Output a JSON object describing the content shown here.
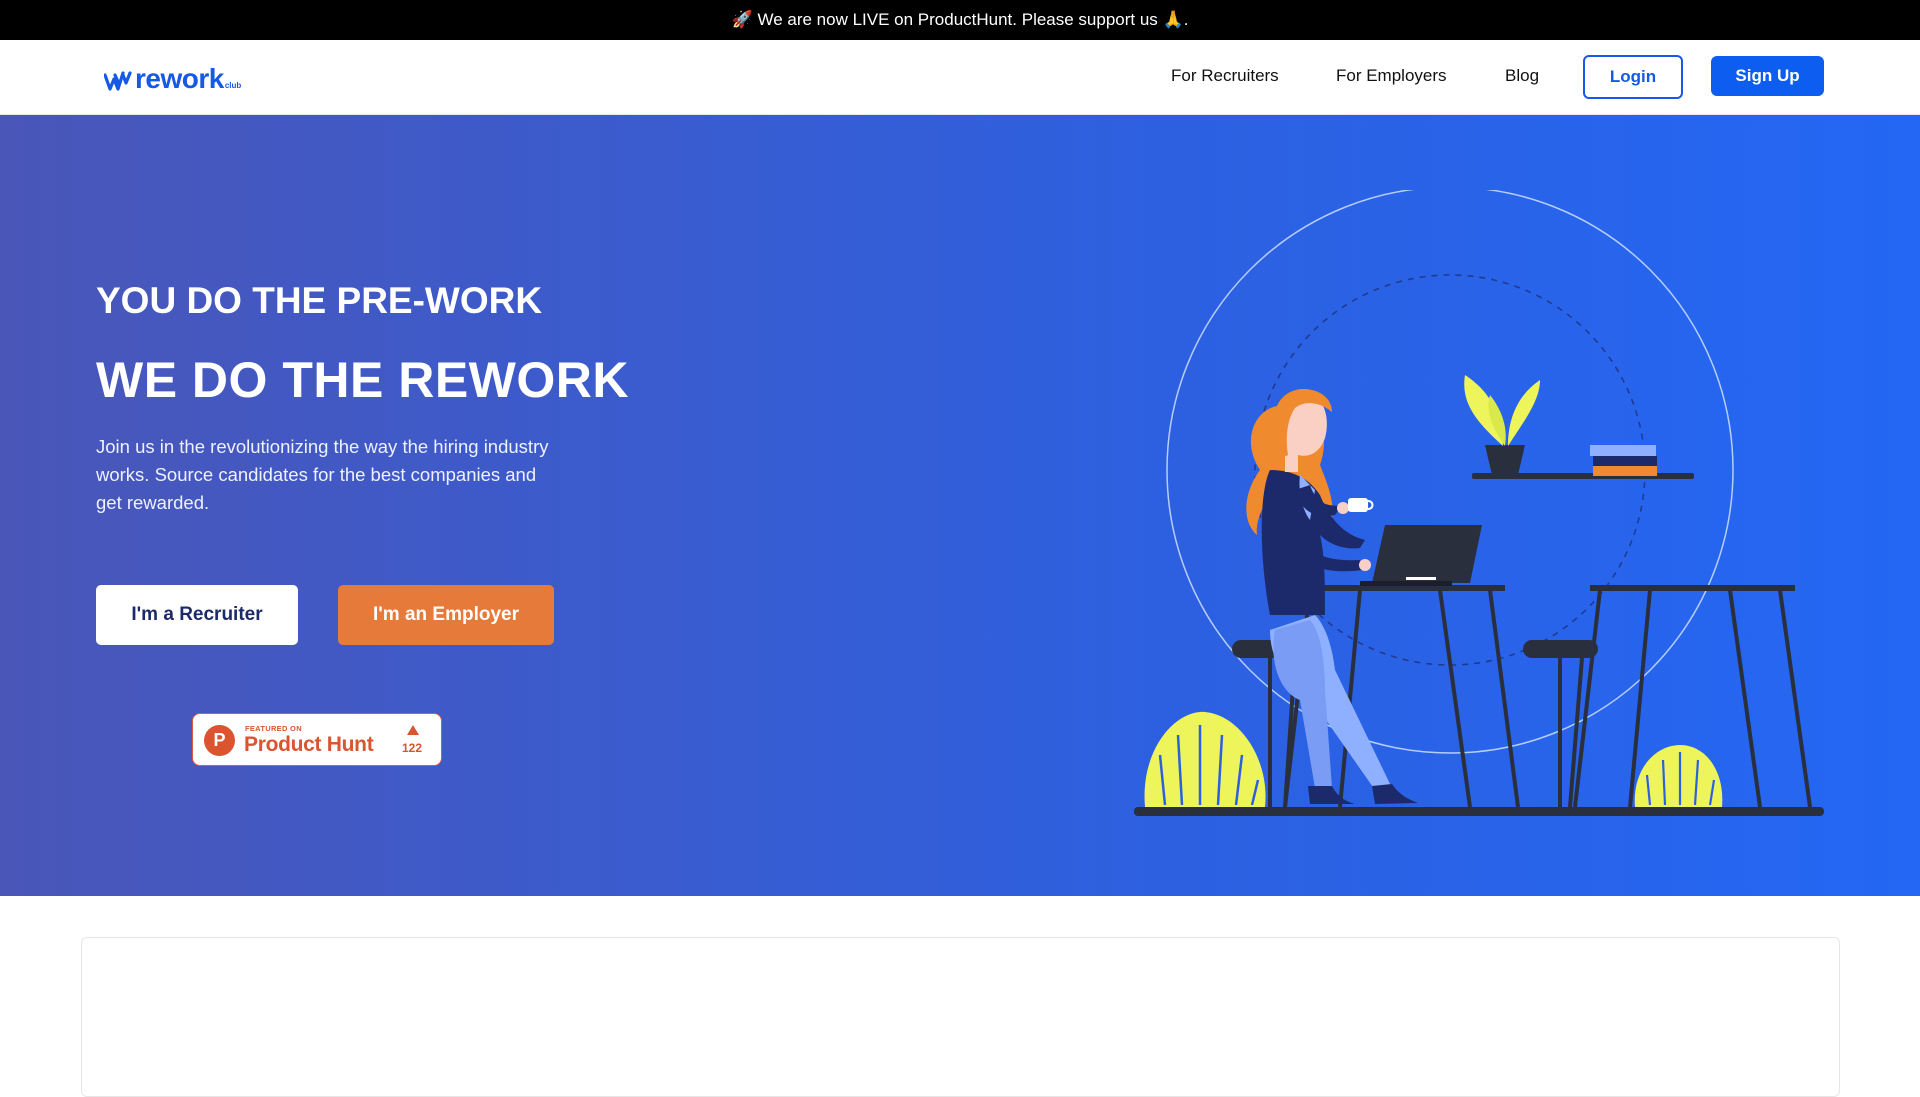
{
  "announcement": {
    "text": "🚀 We are now LIVE on ProductHunt. Please support us 🙏."
  },
  "navbar": {
    "logo_text": "rework",
    "logo_sub": "club",
    "links": [
      "For Recruiters",
      "For Employers",
      "Blog"
    ],
    "login_label": "Login",
    "signup_label": "Sign Up"
  },
  "hero": {
    "kicker": "YOU DO THE PRE-WORK",
    "title": "WE DO THE REWORK",
    "description": "Join us in the revolutionizing the way the hiring industry works. Source candidates for the best companies and get rewarded.",
    "recruiter_button": "I'm a Recruiter",
    "employer_button": "I'm an Employer"
  },
  "product_hunt_badge": {
    "featured_on": "FEATURED ON",
    "name": "Product Hunt",
    "upvotes": "122",
    "logo_letter": "P"
  },
  "colors": {
    "brand_blue": "#1559e6",
    "employer_orange": "#e67a3b",
    "product_hunt": "#da552f",
    "hero_gradient_start": "#4a56b8",
    "hero_gradient_end": "#2467f4"
  },
  "icons": {
    "logo_mark": "double-w-mark-icon",
    "illustration": "woman-at-desk-illustration"
  }
}
